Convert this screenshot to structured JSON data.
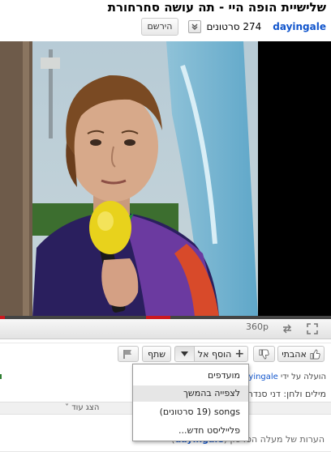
{
  "video": {
    "title": "שלישיית הופה היי - תה עושה סחרחורת"
  },
  "channel": {
    "name": "dayingale",
    "video_count": "274 סרטונים",
    "subscribe_label": "הירשם"
  },
  "player": {
    "quality": "360p",
    "progress_fraction": 0.015
  },
  "actions": {
    "like_label": "אהבתי",
    "add_to_label": "הוסף אל",
    "share_label": "שתף"
  },
  "meta": {
    "uploaded_by_prefix": "הועלה על ידי",
    "uploaded_by_user": "dayingale",
    "lyrics_prefix": "מילים ולחן: דני סנדר"
  },
  "show_more_label": "הצג עוד",
  "comments": {
    "title": "הערות של מעלה הסרטון",
    "user": "dayingale"
  },
  "add_menu": {
    "items": [
      {
        "label": "מועדפים"
      },
      {
        "label": "לצפייה בהמשך"
      },
      {
        "label": "songs (19 סרטונים)"
      },
      {
        "label": "פלייליסט חדש..."
      }
    ]
  },
  "colors": {
    "link": "#1155cc",
    "progress": "#cc181e"
  }
}
